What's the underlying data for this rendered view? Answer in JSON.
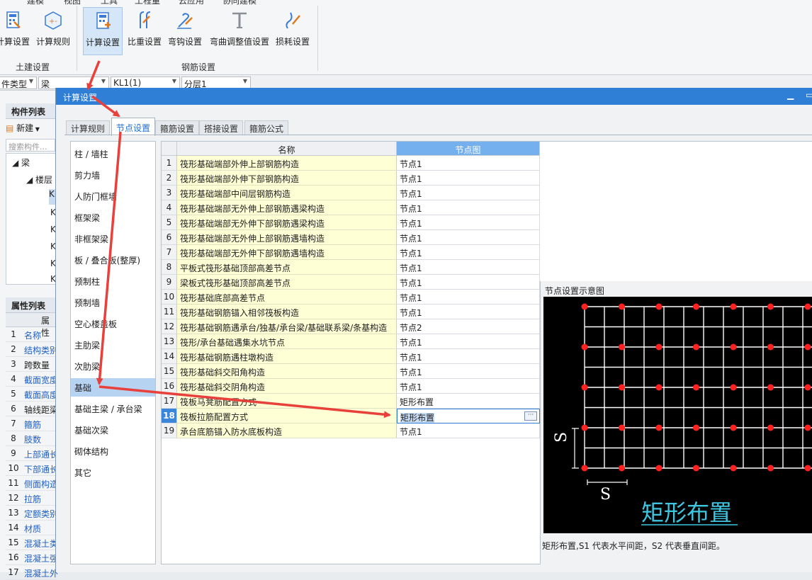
{
  "menu": [
    "建模",
    "视图",
    "工具",
    "工程量",
    "云应用",
    "协同建模"
  ],
  "ribbon": {
    "groups": [
      {
        "label": "土建设置",
        "buttons": [
          "计算设置",
          "计算规则"
        ]
      },
      {
        "label": "钢筋设置",
        "buttons": [
          "计算设置",
          "比重设置",
          "弯钩设置",
          "弯曲调整值设置",
          "损耗设置"
        ]
      }
    ]
  },
  "subbar": {
    "type_label": "件类型",
    "type_value": "梁",
    "element": "KL1(1)",
    "layer": "分层1"
  },
  "left_panel": {
    "component_list_title": "构件列表",
    "new_label": "新建",
    "search_placeholder": "搜索构件...",
    "tree": [
      "梁",
      "楼层"
    ],
    "tree_items": [
      "K",
      "K",
      "K",
      "K",
      "K",
      "K"
    ],
    "property_title": "属性列表",
    "property_header": "属性",
    "properties": [
      {
        "n": "1",
        "t": "名称"
      },
      {
        "n": "2",
        "t": "结构类别"
      },
      {
        "n": "3",
        "t": "跨数量"
      },
      {
        "n": "4",
        "t": "截面宽度"
      },
      {
        "n": "5",
        "t": "截面高度"
      },
      {
        "n": "6",
        "t": "轴线距梁"
      },
      {
        "n": "7",
        "t": "箍筋"
      },
      {
        "n": "8",
        "t": "肢数"
      },
      {
        "n": "9",
        "t": "上部通长"
      },
      {
        "n": "10",
        "t": "下部通长"
      },
      {
        "n": "11",
        "t": "侧面构造"
      },
      {
        "n": "12",
        "t": "拉筋"
      },
      {
        "n": "13",
        "t": "定额类别"
      },
      {
        "n": "14",
        "t": "材质"
      },
      {
        "n": "15",
        "t": "混凝土类"
      },
      {
        "n": "16",
        "t": "混凝土强"
      },
      {
        "n": "17",
        "t": "混凝土外"
      }
    ]
  },
  "dialog": {
    "title": "计算设置",
    "tabs": [
      "计算规则",
      "节点设置",
      "箍筋设置",
      "搭接设置",
      "箍筋公式"
    ],
    "active_tab": 1,
    "categories": [
      "柱 / 墙柱",
      "剪力墙",
      "人防门框墙",
      "框架梁",
      "非框架梁",
      "板 / 叠合板(整厚)",
      "预制柱",
      "预制墙",
      "空心楼盖板",
      "主肋梁",
      "次肋梁",
      "基础",
      "基础主梁 / 承台梁",
      "基础次梁",
      "砌体结构",
      "其它"
    ],
    "selected_category": 11,
    "grid": {
      "col_name": "名称",
      "col_node": "节点图",
      "rows": [
        {
          "i": "1",
          "name": "筏形基础端部外伸上部钢筋构造",
          "node": "节点1"
        },
        {
          "i": "2",
          "name": "筏形基础端部外伸下部钢筋构造",
          "node": "节点1"
        },
        {
          "i": "3",
          "name": "筏形基础端部中间层钢筋构造",
          "node": "节点1"
        },
        {
          "i": "4",
          "name": "筏形基础端部无外伸上部钢筋遇梁构造",
          "node": "节点1"
        },
        {
          "i": "5",
          "name": "筏形基础端部无外伸下部钢筋遇梁构造",
          "node": "节点1"
        },
        {
          "i": "6",
          "name": "筏形基础端部无外伸上部钢筋遇墙构造",
          "node": "节点1"
        },
        {
          "i": "7",
          "name": "筏形基础端部无外伸下部钢筋遇墙构造",
          "node": "节点1"
        },
        {
          "i": "8",
          "name": "平板式筏形基础顶部高差节点",
          "node": "节点1"
        },
        {
          "i": "9",
          "name": "梁板式筏形基础顶部高差节点",
          "node": "节点1"
        },
        {
          "i": "10",
          "name": "筏形基础底部高差节点",
          "node": "节点1"
        },
        {
          "i": "11",
          "name": "筏形基础钢筋锚入相邻筏板构造",
          "node": "节点1"
        },
        {
          "i": "12",
          "name": "筏形基础钢筋遇承台/独基/承台梁/基础联系梁/条基构造",
          "node": "节点2"
        },
        {
          "i": "13",
          "name": "筏形/承台基础遇集水坑节点",
          "node": "节点1"
        },
        {
          "i": "14",
          "name": "筏形基础钢筋遇柱墩构造",
          "node": "节点1"
        },
        {
          "i": "15",
          "name": "筏形基础斜交阳角构造",
          "node": "节点1"
        },
        {
          "i": "16",
          "name": "筏形基础斜交阴角构造",
          "node": "节点1"
        },
        {
          "i": "17",
          "name": "筏板马凳筋配置方式",
          "node": "矩形布置"
        },
        {
          "i": "18",
          "name": "筏板拉筋配置方式",
          "node": "矩形布置"
        },
        {
          "i": "19",
          "name": "承台底筋锚入防水底板构造",
          "node": "节点1"
        }
      ],
      "selected_row": 17,
      "ellipsis": "···"
    },
    "diagram": {
      "title": "节点设置示意图",
      "caption": "矩形布置",
      "label_s_vertical": "S",
      "label_s_horizontal": "S",
      "description": "矩形布置,S1 代表水平间距，S2 代表垂直间距。"
    }
  },
  "colors": {
    "title_bar": "#2f7fd6",
    "arrow": "#e8413c",
    "dot": "#ff2020",
    "caption": "#3ec6e0"
  }
}
